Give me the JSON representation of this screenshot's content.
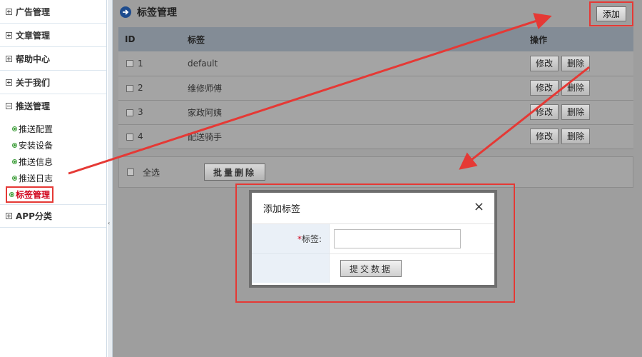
{
  "sidebar": {
    "groups": [
      {
        "label": "广告管理",
        "expanded": false
      },
      {
        "label": "文章管理",
        "expanded": false
      },
      {
        "label": "帮助中心",
        "expanded": false
      },
      {
        "label": "关于我们",
        "expanded": false
      },
      {
        "label": "推送管理",
        "expanded": true
      },
      {
        "label": "APP分类",
        "expanded": false
      }
    ],
    "push_items": [
      {
        "label": "推送配置"
      },
      {
        "label": "安装设备"
      },
      {
        "label": "推送信息"
      },
      {
        "label": "推送日志"
      },
      {
        "label": "标签管理",
        "active": true
      }
    ],
    "collapse_glyph": "‹"
  },
  "header": {
    "title": "标签管理",
    "add_label": "添加"
  },
  "table": {
    "columns": {
      "id": "ID",
      "tag": "标签",
      "ops": "操作"
    },
    "rows": [
      {
        "id": "1",
        "tag": "default"
      },
      {
        "id": "2",
        "tag": "维修师傅"
      },
      {
        "id": "3",
        "tag": "家政阿姨"
      },
      {
        "id": "4",
        "tag": "配送骑手"
      }
    ],
    "edit_label": "修改",
    "delete_label": "删除"
  },
  "bulk": {
    "select_all_label": "全选",
    "batch_delete_label": "批量删除"
  },
  "modal": {
    "title": "添加标签",
    "close_glyph": "×",
    "required_mark": "*",
    "field_label": "标签:",
    "field_value": "",
    "submit_label": "提交数据"
  },
  "colors": {
    "annotation_red": "#e53935",
    "title_icon_blue": "#1e4c8e",
    "overlay_gray": "#9e9e9e"
  }
}
